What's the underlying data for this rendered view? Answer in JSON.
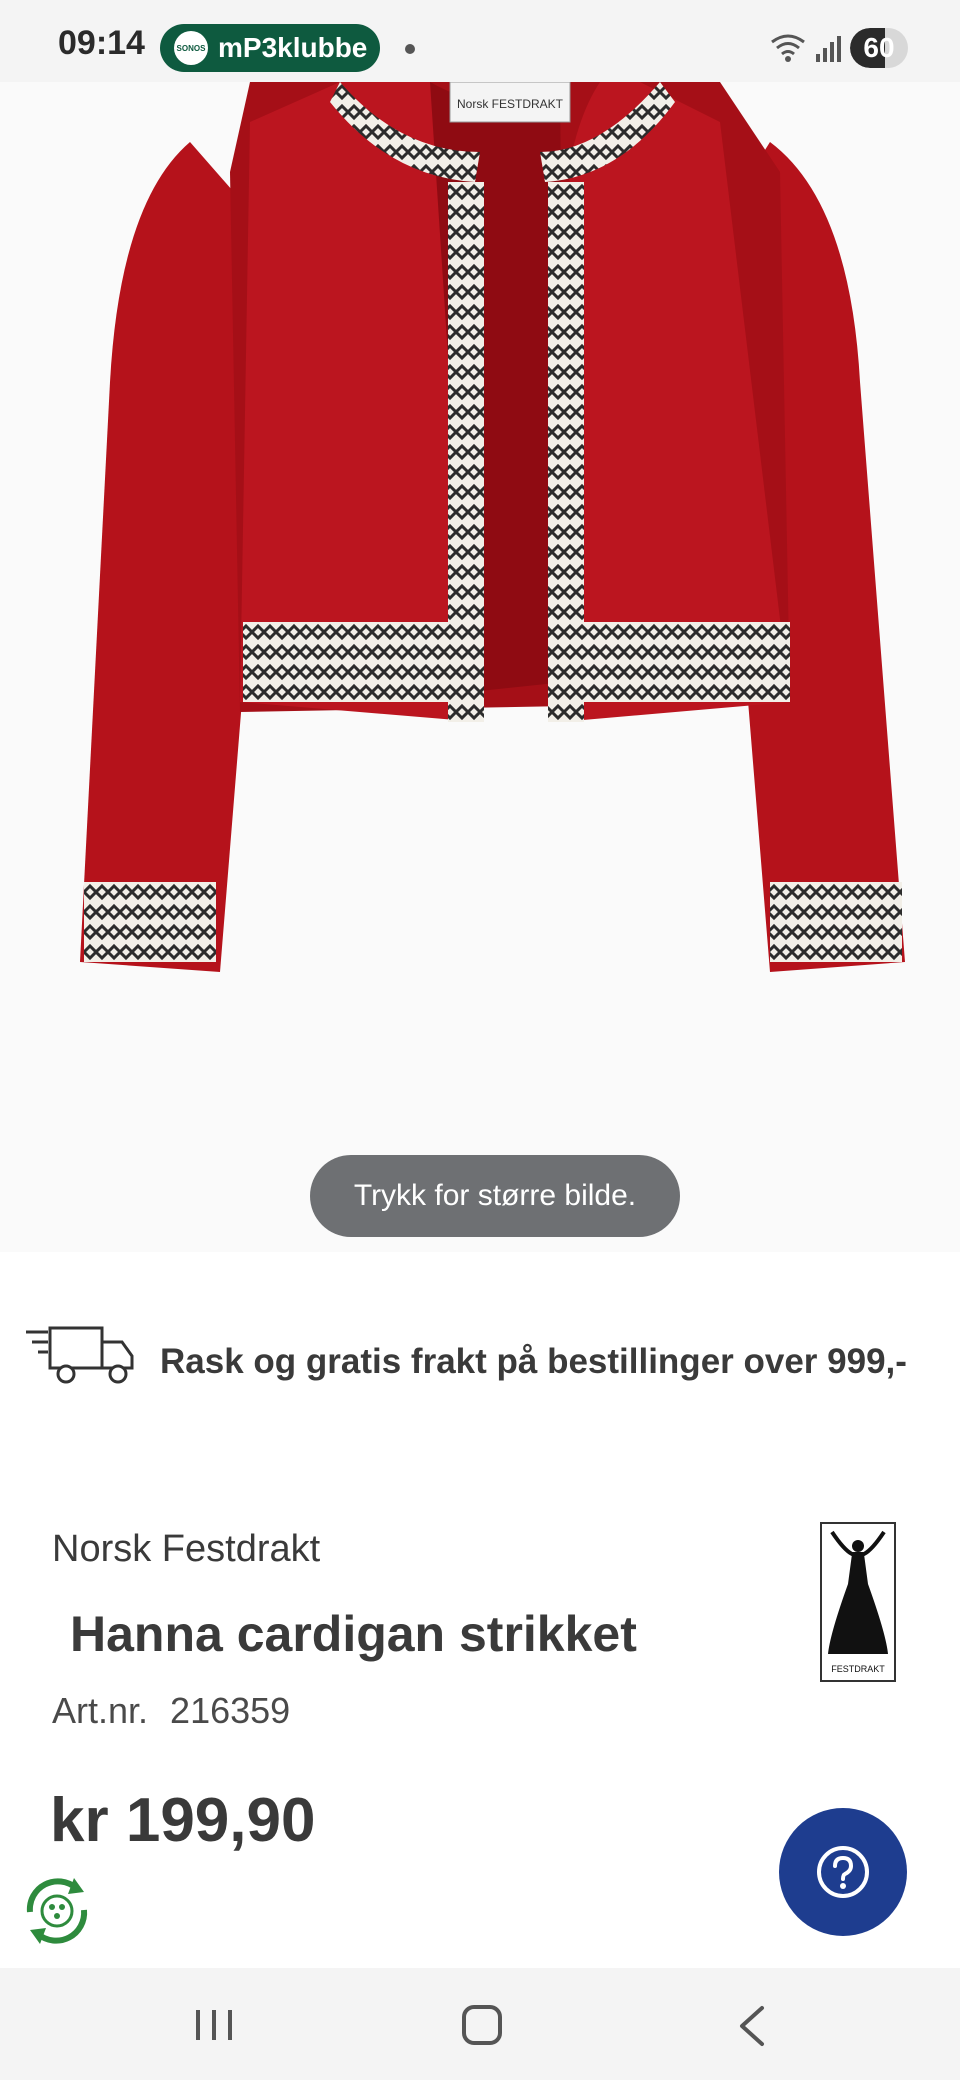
{
  "status_bar": {
    "time": "09:14",
    "sonos_badge": "SONOS",
    "notification_app": "mP3klubbe",
    "battery_level": 60,
    "battery_text": "60"
  },
  "product_image": {
    "tap_hint": "Trykk for større bilde.",
    "label_text": "Norsk FESTDRAKT"
  },
  "shipping": {
    "text": "Rask og gratis frakt på bestillinger over 999,-"
  },
  "product": {
    "brand": "Norsk Festdrakt",
    "title": "Hanna cardigan strikket",
    "artnr_label": "Art.nr.",
    "artnr_value": "216359",
    "price": "kr 199,90",
    "logo_text": "FESTDRAKT"
  },
  "colors": {
    "accent": "#1e3d8f",
    "sonos_green": "#0e5a3f",
    "cardigan_red": "#b5121b"
  },
  "icons": {
    "help": "question-icon",
    "truck": "truck-icon",
    "eco": "recycle-icon"
  }
}
